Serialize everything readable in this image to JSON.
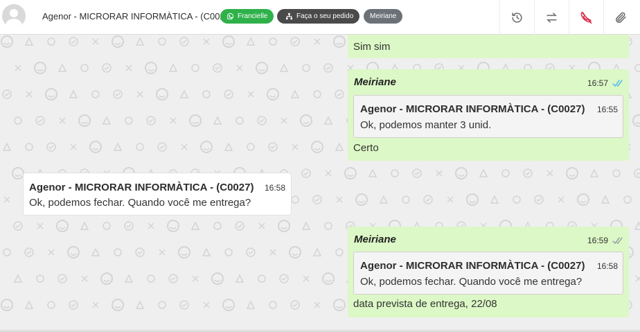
{
  "header": {
    "contact_name": "Agenor - MICRORAR INFORMÀTICA - (C0027)",
    "tags": [
      {
        "label": "Francielle",
        "icon": "whatsapp-icon",
        "color": "#2fb14a"
      },
      {
        "label": "Faça o seu pedido",
        "icon": "sitemap-icon",
        "color": "#4a4a4a"
      },
      {
        "label": "Meiriane",
        "color": "#6b7177"
      }
    ],
    "actions": [
      "history-icon",
      "transfer-icon",
      "hangup-icon",
      "attach-icon"
    ]
  },
  "messages": [
    {
      "direction": "out",
      "text": "Sim sim"
    },
    {
      "direction": "out",
      "sender": "Meiriane",
      "time": "16:57",
      "status": "read",
      "quote": {
        "author": "Agenor - MICRORAR INFORMÀTICA - (C0027)",
        "time": "16:55",
        "text": "Ok, podemos manter 3 unid."
      },
      "text": "Certo"
    },
    {
      "direction": "in",
      "sender": "Agenor - MICRORAR INFORMÀTICA - (C0027)",
      "time": "16:58",
      "text": "Ok, podemos fechar. Quando você me entrega?"
    },
    {
      "direction": "out",
      "sender": "Meiriane",
      "time": "16:59",
      "status": "delivered",
      "quote": {
        "author": "Agenor - MICRORAR INFORMÀTICA - (C0027)",
        "time": "16:58",
        "text": "Ok, podemos fechar. Quando você me entrega?"
      },
      "text": "data prevista de entrega, 22/08"
    }
  ],
  "colors": {
    "outgoing_bubble": "#dcf8c6",
    "incoming_bubble": "#ffffff",
    "read_ticks": "#53bdeb",
    "delivered_ticks": "#9aa0a6",
    "hangup": "#d9304a"
  }
}
